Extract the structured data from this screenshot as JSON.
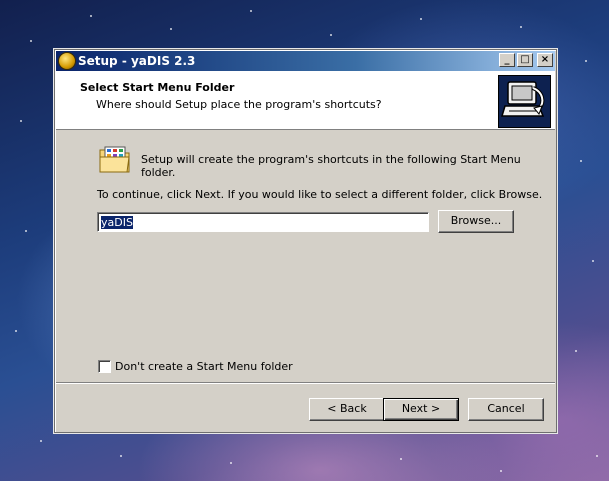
{
  "window": {
    "title": "Setup - yaDIS 2.3",
    "minimize_glyph": "_",
    "maximize_glyph": "□",
    "close_glyph": "×"
  },
  "header": {
    "title": "Select Start Menu Folder",
    "subtitle": "Where should Setup place the program's shortcuts?"
  },
  "body": {
    "info": "Setup will create the program's shortcuts in the following Start Menu folder.",
    "instruction": "To continue, click Next. If you would like to select a different folder, click Browse.",
    "folder_value": "yaDIS",
    "browse_label": "Browse...",
    "no_folder_checkbox_label": "Don't create a Start Menu folder",
    "no_folder_checked": false
  },
  "footer": {
    "back_label": "< Back",
    "next_label": "Next >",
    "cancel_label": "Cancel"
  },
  "icons": {
    "app": "setup-app-icon",
    "header": "computer-install-icon",
    "folder": "start-menu-folder-icon"
  }
}
